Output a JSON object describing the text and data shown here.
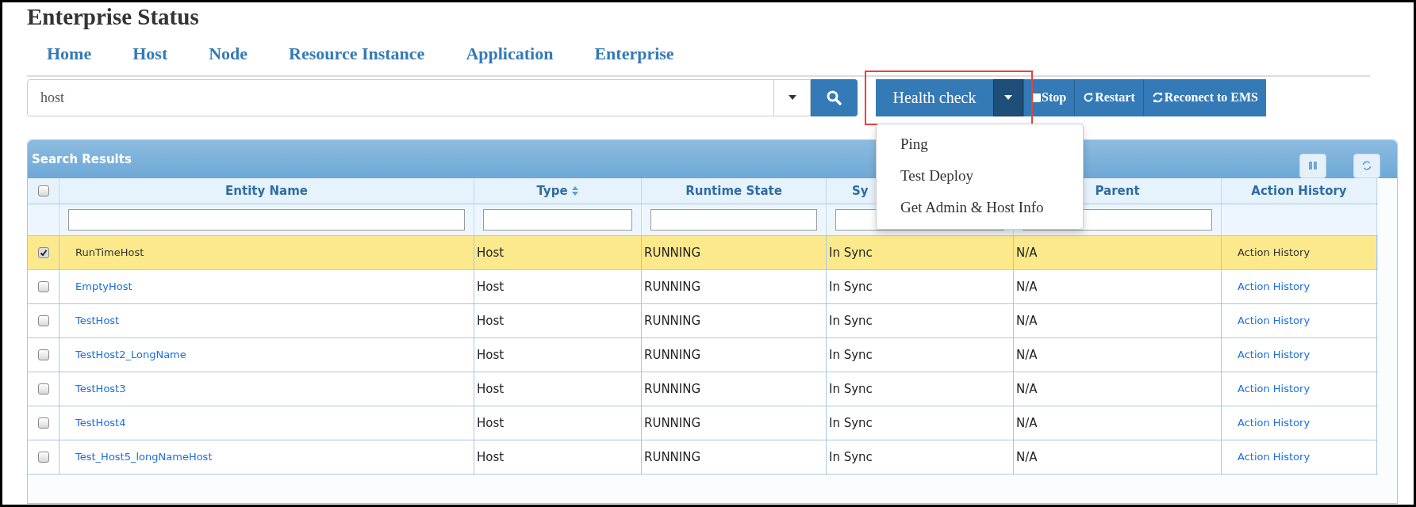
{
  "title": "Enterprise Status",
  "nav": [
    "Home",
    "Host",
    "Node",
    "Resource Instance",
    "Application",
    "Enterprise"
  ],
  "search": {
    "value": "host"
  },
  "toolbar": {
    "primary": {
      "label": "Health check",
      "highlighted": true,
      "expanded": true
    },
    "buttons": [
      {
        "label": "Stop",
        "kind": "stop"
      },
      {
        "label": "Restart",
        "kind": "restart"
      },
      {
        "label": "Reconect to EMS",
        "kind": "reconnect"
      }
    ]
  },
  "menu": {
    "items": [
      "Ping",
      "Test Deploy",
      "Get Admin & Host Info"
    ]
  },
  "panel": {
    "title": "Search Results"
  },
  "table": {
    "header_checked": false,
    "columns": [
      {
        "label": "Entity Name",
        "sorted": false,
        "filter": true
      },
      {
        "label": "Type",
        "sorted": true,
        "filter": true
      },
      {
        "label": "Runtime State",
        "sorted": false,
        "filter": true
      },
      {
        "label": "Sy",
        "sorted": false,
        "filter": true
      },
      {
        "label": "Parent",
        "sorted": false,
        "filter": true
      },
      {
        "label": "Action History",
        "sorted": false,
        "filter": false
      }
    ],
    "rows": [
      {
        "selected": true,
        "checked": true,
        "cells": [
          "RunTimeHost",
          "Host",
          "RUNNING",
          "In Sync",
          "N/A",
          "Action History"
        ]
      },
      {
        "selected": false,
        "checked": false,
        "cells": [
          "EmptyHost",
          "Host",
          "RUNNING",
          "In Sync",
          "N/A",
          "Action History"
        ]
      },
      {
        "selected": false,
        "checked": false,
        "cells": [
          "TestHost",
          "Host",
          "RUNNING",
          "In Sync",
          "N/A",
          "Action History"
        ]
      },
      {
        "selected": false,
        "checked": false,
        "cells": [
          "TestHost2_LongName",
          "Host",
          "RUNNING",
          "In Sync",
          "N/A",
          "Action History"
        ]
      },
      {
        "selected": false,
        "checked": false,
        "cells": [
          "TestHost3",
          "Host",
          "RUNNING",
          "In Sync",
          "N/A",
          "Action History"
        ]
      },
      {
        "selected": false,
        "checked": false,
        "cells": [
          "TestHost4",
          "Host",
          "RUNNING",
          "In Sync",
          "N/A",
          "Action History"
        ]
      },
      {
        "selected": false,
        "checked": false,
        "cells": [
          "Test_Host5_longNameHost",
          "Host",
          "RUNNING",
          "In Sync",
          "N/A",
          "Action History"
        ]
      }
    ]
  }
}
